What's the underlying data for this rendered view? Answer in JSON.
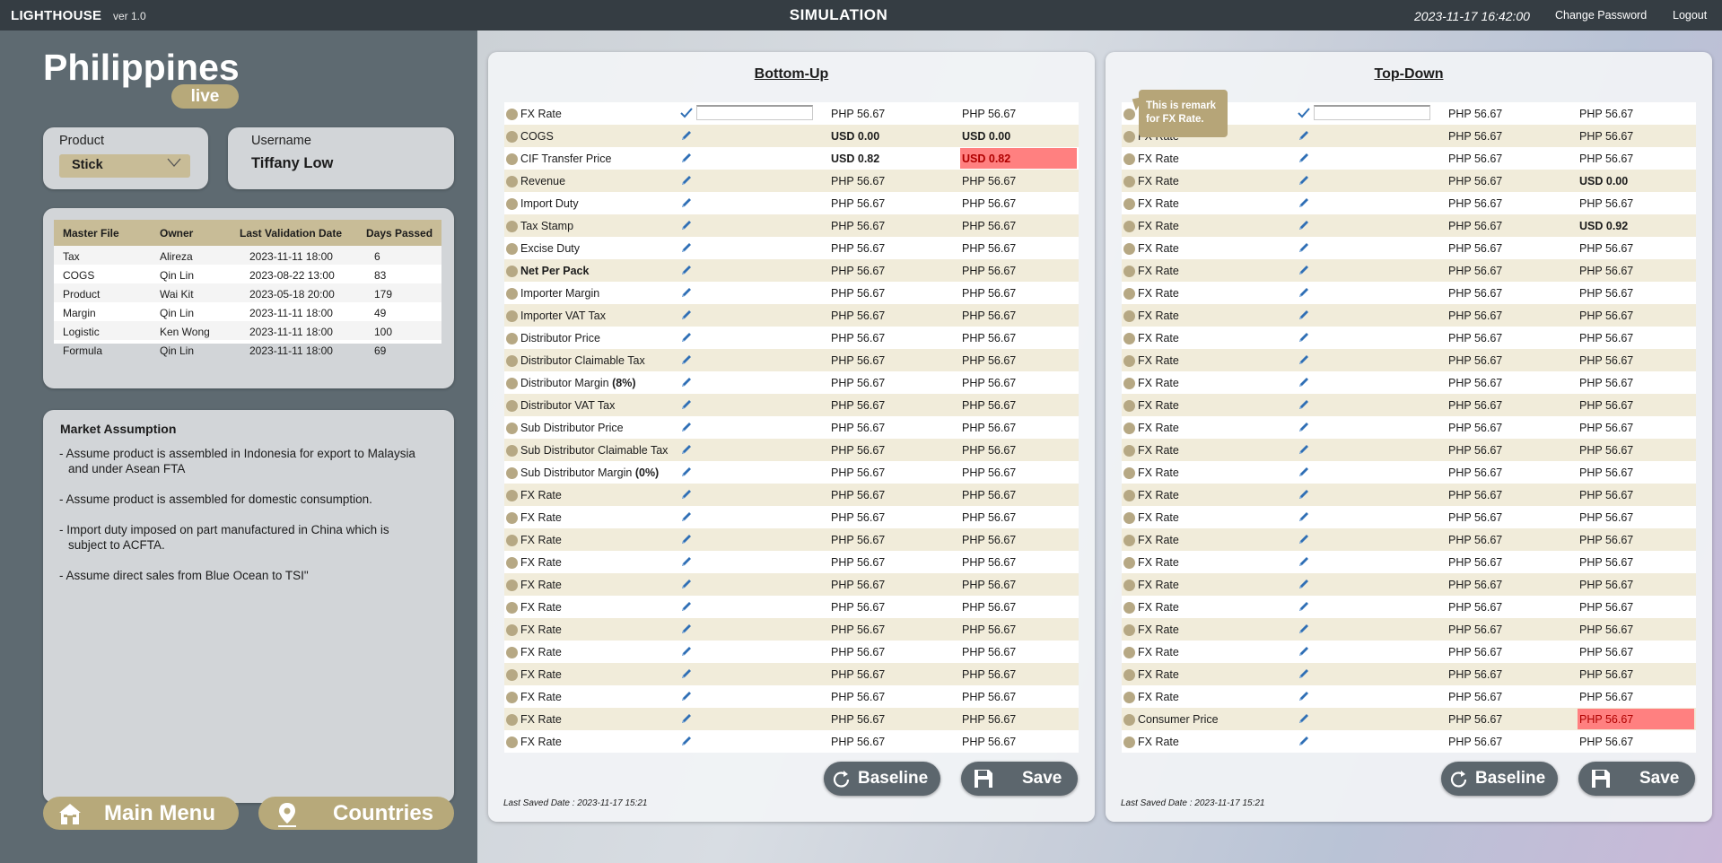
{
  "topbar": {
    "brand": "LIGHTHOUSE",
    "version": "ver 1.0",
    "title": "SIMULATION",
    "datetime": "2023-11-17 16:42:00",
    "change_password": "Change Password",
    "logout": "Logout"
  },
  "sidebar": {
    "country": "Philippines",
    "status_badge": "live",
    "product_label": "Product",
    "product_value": "Stick",
    "username_label": "Username",
    "username_value": "Tiffany Low",
    "master_table": {
      "headers": [
        "Master File",
        "Owner",
        "Last Validation Date",
        "Days Passed"
      ],
      "rows": [
        [
          "Tax",
          "Alireza",
          "2023-11-11 18:00",
          "6"
        ],
        [
          "COGS",
          "Qin Lin",
          "2023-08-22 13:00",
          "83"
        ],
        [
          "Product",
          "Wai Kit",
          "2023-05-18 20:00",
          "179"
        ],
        [
          "Margin",
          "Qin Lin",
          "2023-11-11 18:00",
          "49"
        ],
        [
          "Logistic",
          "Ken Wong",
          "2023-11-11 18:00",
          "100"
        ],
        [
          "Formula",
          "Qin Lin",
          "2023-11-11 18:00",
          "69"
        ]
      ]
    },
    "market_assumption": {
      "title": "Market Assumption",
      "items": [
        "- Assume product is assembled in Indonesia for export to Malaysia and under Asean FTA",
        "- Assume product is assembled for domestic consumption.",
        "- Import duty imposed on part manufactured in China which is subject to ACFTA.",
        "- Assume direct sales from Blue Ocean to TSI\""
      ]
    },
    "main_menu": "Main Menu",
    "countries": "Countries"
  },
  "colors": {
    "accent_gold": "#b7a97a",
    "highlight_red": "#ff8080",
    "edit_blue": "#2f6fb5"
  },
  "bottom_up": {
    "title": "Bottom-Up",
    "baseline": "Baseline",
    "save": "Save",
    "last_saved": "Last Saved Date : 2023-11-17 15:21",
    "rows": [
      {
        "label": "FX Rate",
        "icon": "check-icon",
        "input": true,
        "v1": "PHP 56.67",
        "v2": "PHP 56.67"
      },
      {
        "label": "COGS",
        "v1": "USD 0.00",
        "v2": "USD 0.00",
        "v1bold": true,
        "v2bold": true
      },
      {
        "label": "CIF Transfer Price",
        "v1": "USD 0.82",
        "v2": "USD 0.82",
        "v1bold": true,
        "v2bold": true,
        "v2hl": true
      },
      {
        "label": "Revenue",
        "v1": "PHP 56.67",
        "v2": "PHP 56.67"
      },
      {
        "label": "Import Duty",
        "v1": "PHP 56.67",
        "v2": "PHP 56.67"
      },
      {
        "label": "Tax Stamp",
        "v1": "PHP 56.67",
        "v2": "PHP 56.67"
      },
      {
        "label": "Excise Duty",
        "v1": "PHP 56.67",
        "v2": "PHP 56.67"
      },
      {
        "label": "Net Per Pack",
        "labelbold": true,
        "v1": "PHP 56.67",
        "v2": "PHP 56.67"
      },
      {
        "label": "Importer Margin",
        "v1": "PHP 56.67",
        "v2": "PHP 56.67"
      },
      {
        "label": "Importer VAT Tax",
        "v1": "PHP 56.67",
        "v2": "PHP 56.67"
      },
      {
        "label": "Distributor Price",
        "v1": "PHP 56.67",
        "v2": "PHP 56.67"
      },
      {
        "label": "Distributor Claimable Tax",
        "v1": "PHP 56.67",
        "v2": "PHP 56.67"
      },
      {
        "label": "Distributor Margin ",
        "suffix": "(8%)",
        "v1": "PHP 56.67",
        "v2": "PHP 56.67"
      },
      {
        "label": "Distributor VAT Tax",
        "v1": "PHP 56.67",
        "v2": "PHP 56.67"
      },
      {
        "label": "Sub Distributor Price",
        "v1": "PHP 56.67",
        "v2": "PHP 56.67"
      },
      {
        "label": "Sub Distributor Claimable Tax",
        "v1": "PHP 56.67",
        "v2": "PHP 56.67"
      },
      {
        "label": "Sub Distributor Margin ",
        "suffix": "(0%)",
        "v1": "PHP 56.67",
        "v2": "PHP 56.67"
      },
      {
        "label": "FX Rate",
        "v1": "PHP 56.67",
        "v2": "PHP 56.67"
      },
      {
        "label": "FX Rate",
        "v1": "PHP 56.67",
        "v2": "PHP 56.67"
      },
      {
        "label": "FX Rate",
        "v1": "PHP 56.67",
        "v2": "PHP 56.67"
      },
      {
        "label": "FX Rate",
        "v1": "PHP 56.67",
        "v2": "PHP 56.67"
      },
      {
        "label": "FX Rate",
        "v1": "PHP 56.67",
        "v2": "PHP 56.67"
      },
      {
        "label": "FX Rate",
        "v1": "PHP 56.67",
        "v2": "PHP 56.67"
      },
      {
        "label": "FX Rate",
        "v1": "PHP 56.67",
        "v2": "PHP 56.67"
      },
      {
        "label": "FX Rate",
        "v1": "PHP 56.67",
        "v2": "PHP 56.67"
      },
      {
        "label": "FX Rate",
        "v1": "PHP 56.67",
        "v2": "PHP 56.67"
      },
      {
        "label": "FX Rate",
        "v1": "PHP 56.67",
        "v2": "PHP 56.67"
      },
      {
        "label": "FX Rate",
        "v1": "PHP 56.67",
        "v2": "PHP 56.67"
      },
      {
        "label": "FX Rate",
        "v1": "PHP 56.67",
        "v2": "PHP 56.67"
      }
    ]
  },
  "top_down": {
    "title": "Top-Down",
    "baseline": "Baseline",
    "save": "Save",
    "last_saved": "Last Saved Date : 2023-11-17 15:21",
    "remark": "This is remark for FX Rate.",
    "rows": [
      {
        "label": "",
        "icon": "check-icon",
        "input": true,
        "v1": "PHP 56.67",
        "v2": "PHP 56.67"
      },
      {
        "label": "FX Rate",
        "v1": "PHP 56.67",
        "v2": "PHP 56.67"
      },
      {
        "label": "FX Rate",
        "v1": "PHP 56.67",
        "v2": "PHP 56.67"
      },
      {
        "label": "FX Rate",
        "v1": "PHP 56.67",
        "v2": "USD 0.00",
        "v2bold": true
      },
      {
        "label": "FX Rate",
        "v1": "PHP 56.67",
        "v2": "PHP 56.67"
      },
      {
        "label": "FX Rate",
        "v1": "PHP 56.67",
        "v2": "USD 0.92",
        "v2bold": true
      },
      {
        "label": "FX Rate",
        "v1": "PHP 56.67",
        "v2": "PHP 56.67"
      },
      {
        "label": "FX Rate",
        "v1": "PHP 56.67",
        "v2": "PHP 56.67"
      },
      {
        "label": "FX Rate",
        "v1": "PHP 56.67",
        "v2": "PHP 56.67"
      },
      {
        "label": "FX Rate",
        "v1": "PHP 56.67",
        "v2": "PHP 56.67"
      },
      {
        "label": "FX Rate",
        "v1": "PHP 56.67",
        "v2": "PHP 56.67"
      },
      {
        "label": "FX Rate",
        "v1": "PHP 56.67",
        "v2": "PHP 56.67"
      },
      {
        "label": "FX Rate",
        "v1": "PHP 56.67",
        "v2": "PHP 56.67"
      },
      {
        "label": "FX Rate",
        "v1": "PHP 56.67",
        "v2": "PHP 56.67"
      },
      {
        "label": "FX Rate",
        "v1": "PHP 56.67",
        "v2": "PHP 56.67"
      },
      {
        "label": "FX Rate",
        "v1": "PHP 56.67",
        "v2": "PHP 56.67"
      },
      {
        "label": "FX Rate",
        "v1": "PHP 56.67",
        "v2": "PHP 56.67"
      },
      {
        "label": "FX Rate",
        "v1": "PHP 56.67",
        "v2": "PHP 56.67"
      },
      {
        "label": "FX Rate",
        "v1": "PHP 56.67",
        "v2": "PHP 56.67"
      },
      {
        "label": "FX Rate",
        "v1": "PHP 56.67",
        "v2": "PHP 56.67"
      },
      {
        "label": "FX Rate",
        "v1": "PHP 56.67",
        "v2": "PHP 56.67"
      },
      {
        "label": "FX Rate",
        "v1": "PHP 56.67",
        "v2": "PHP 56.67"
      },
      {
        "label": "FX Rate",
        "v1": "PHP 56.67",
        "v2": "PHP 56.67"
      },
      {
        "label": "FX Rate",
        "v1": "PHP 56.67",
        "v2": "PHP 56.67"
      },
      {
        "label": "FX Rate",
        "v1": "PHP 56.67",
        "v2": "PHP 56.67"
      },
      {
        "label": "FX Rate",
        "v1": "PHP 56.67",
        "v2": "PHP 56.67"
      },
      {
        "label": "FX Rate",
        "v1": "PHP 56.67",
        "v2": "PHP 56.67"
      },
      {
        "label": "Consumer Price",
        "v1": "PHP 56.67",
        "v2": "PHP 56.67",
        "v2hl": true
      },
      {
        "label": "FX Rate",
        "v1": "PHP 56.67",
        "v2": "PHP 56.67"
      }
    ]
  }
}
